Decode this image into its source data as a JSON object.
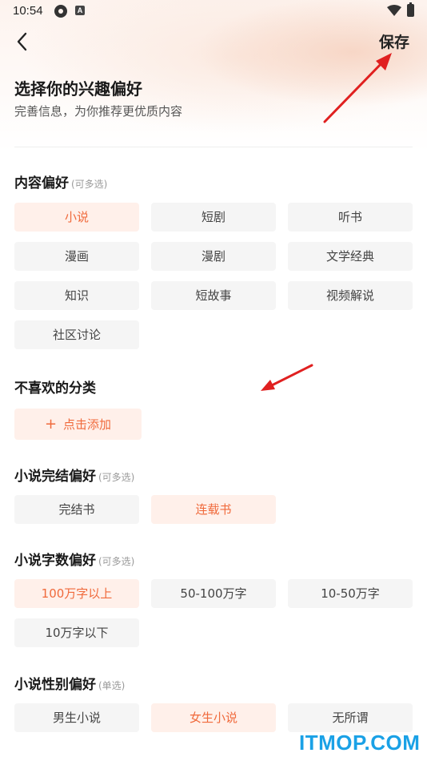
{
  "status_bar": {
    "time": "10:54",
    "badge_letter": "A"
  },
  "header": {
    "save_label": "保存",
    "title": "选择你的兴趣偏好",
    "subtitle": "完善信息，为你推荐更优质内容"
  },
  "sections": {
    "content": {
      "title": "内容偏好",
      "hint": "(可多选)",
      "options": [
        {
          "label": "小说",
          "selected": true
        },
        {
          "label": "短剧",
          "selected": false
        },
        {
          "label": "听书",
          "selected": false
        },
        {
          "label": "漫画",
          "selected": false
        },
        {
          "label": "漫剧",
          "selected": false
        },
        {
          "label": "文学经典",
          "selected": false
        },
        {
          "label": "知识",
          "selected": false
        },
        {
          "label": "短故事",
          "selected": false
        },
        {
          "label": "视频解说",
          "selected": false
        },
        {
          "label": "社区讨论",
          "selected": false
        }
      ]
    },
    "dislike": {
      "title": "不喜欢的分类",
      "add_icon": "+",
      "add_label": "点击添加"
    },
    "completion": {
      "title": "小说完结偏好",
      "hint": "(可多选)",
      "options": [
        {
          "label": "完结书",
          "selected": false
        },
        {
          "label": "连载书",
          "selected": true
        }
      ]
    },
    "word_count": {
      "title": "小说字数偏好",
      "hint": "(可多选)",
      "options": [
        {
          "label": "100万字以上",
          "selected": true
        },
        {
          "label": "50-100万字",
          "selected": false
        },
        {
          "label": "10-50万字",
          "selected": false
        },
        {
          "label": "10万字以下",
          "selected": false
        }
      ]
    },
    "gender": {
      "title": "小说性别偏好",
      "hint": "(单选)",
      "options": [
        {
          "label": "男生小说",
          "selected": false
        },
        {
          "label": "女生小说",
          "selected": true
        },
        {
          "label": "无所谓",
          "selected": false
        }
      ]
    }
  },
  "theme": {
    "accent": "#f06a3c",
    "chip_selected_bg": "#fff0ea",
    "chip_bg": "#f5f5f5",
    "annotation_arrow": "#e02020"
  },
  "icons": {
    "back": "chevron-left-icon",
    "add": "plus-icon",
    "wifi": "wifi-icon",
    "battery": "battery-icon"
  },
  "watermark": "ITMOP.COM"
}
